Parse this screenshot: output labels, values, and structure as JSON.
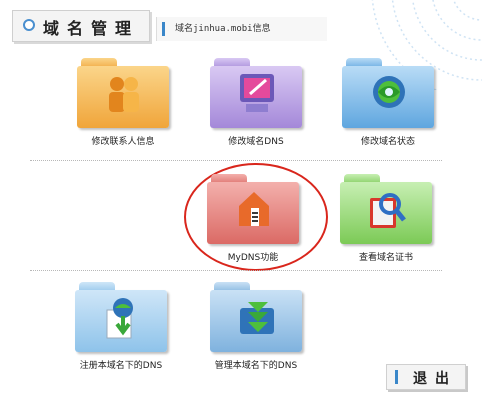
{
  "header": {
    "title": "域名管理",
    "info": "域名jinhua.mobi信息"
  },
  "items": [
    {
      "label": "修改联系人信息",
      "icon": "contacts-icon"
    },
    {
      "label": "修改域名DNS",
      "icon": "monitor-edit-icon"
    },
    {
      "label": "修改域名状态",
      "icon": "globe-status-icon"
    },
    {
      "label": "MyDNS功能",
      "icon": "mydns-house-icon"
    },
    {
      "label": "查看域名证书",
      "icon": "certificate-search-icon"
    },
    {
      "label": "注册本域名下的DNS",
      "icon": "register-dns-icon"
    },
    {
      "label": "管理本域名下的DNS",
      "icon": "manage-dns-icon"
    }
  ],
  "footer": {
    "exit_label": "退出"
  },
  "colors": {
    "accent": "#3a87c9",
    "highlight": "#d9261c"
  }
}
